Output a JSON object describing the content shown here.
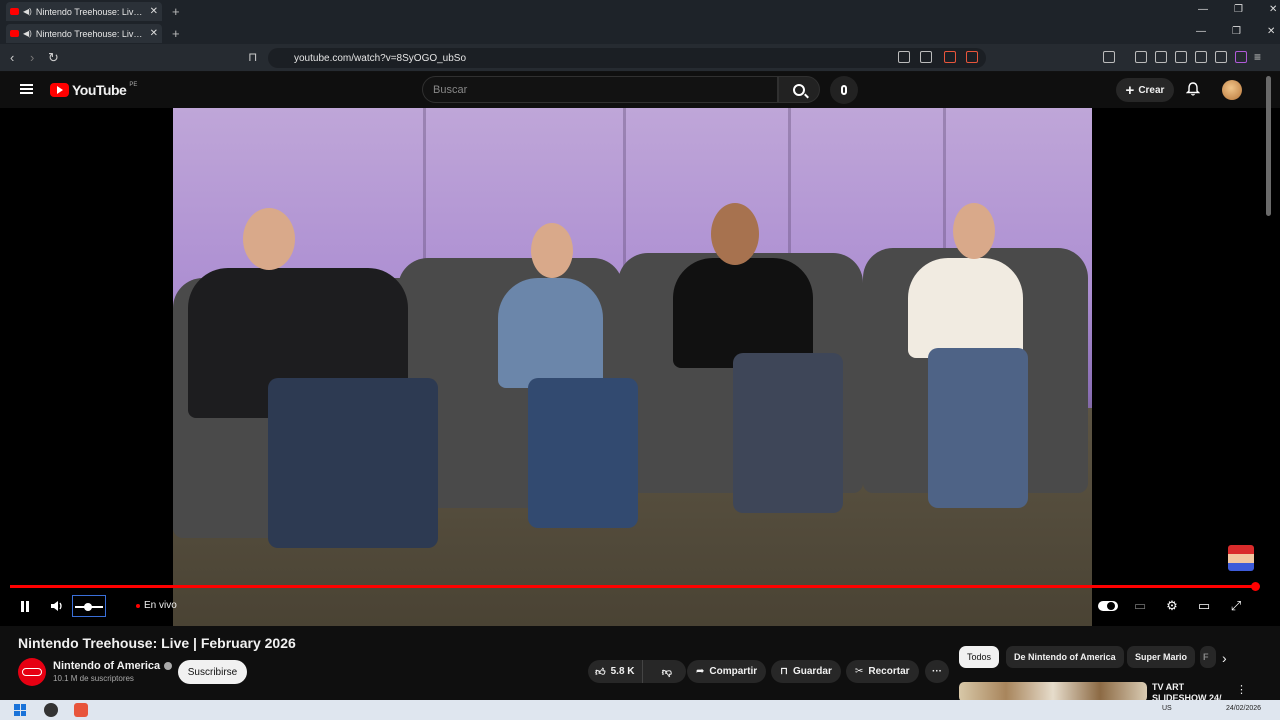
{
  "browser": {
    "tabs": [
      {
        "title": "Nintendo Treehouse: Live | Fe"
      },
      {
        "title": "Nintendo Treehouse: Live | Fe"
      }
    ],
    "url": "youtube.com/watch?v=8SyOGO_ubSo"
  },
  "youtube": {
    "logo_text": "YouTube",
    "region": "PE",
    "search_placeholder": "Buscar",
    "create_label": "Crear"
  },
  "player": {
    "live_label": "En vivo",
    "progress_fraction": 1.0,
    "volume_fraction": 0.45
  },
  "video": {
    "title": "Nintendo Treehouse: Live | February 2026",
    "channel_name": "Nintendo of America",
    "subscribers": "10.1 M de suscriptores",
    "subscribe_label": "Suscribirse",
    "likes": "5.8 K",
    "share_label": "Compartir",
    "save_label": "Guardar",
    "clip_label": "Recortar"
  },
  "sidebar": {
    "chips": [
      "Todos",
      "De Nintendo of America",
      "Super Mario",
      "F"
    ],
    "first_rec_title": "TV ART SLIDESHOW 24/"
  },
  "taskbar": {
    "lang": "US",
    "date": "24/02/2026"
  },
  "colors": {
    "yt_red": "#ff0000",
    "page_bg": "#0f0f0f"
  }
}
